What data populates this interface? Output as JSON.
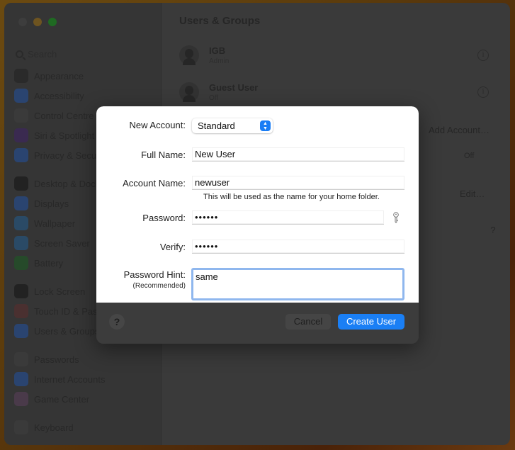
{
  "window": {
    "title": "Users & Groups"
  },
  "sidebar": {
    "search_placeholder": "Search",
    "groups": [
      [
        {
          "label": "Appearance",
          "icon": "appearance-icon",
          "color": "#2a2a2a"
        },
        {
          "label": "Accessibility",
          "icon": "accessibility-icon",
          "color": "#2a4470"
        },
        {
          "label": "Control Centre",
          "icon": "control-centre-icon",
          "color": "#3a3a3a"
        },
        {
          "label": "Siri & Spotlight",
          "icon": "siri-icon",
          "color": "#3a2a50"
        },
        {
          "label": "Privacy & Security",
          "icon": "privacy-hand-icon",
          "color": "#2a4470"
        }
      ],
      [
        {
          "label": "Desktop & Dock",
          "icon": "desktop-dock-icon",
          "color": "#222222"
        },
        {
          "label": "Displays",
          "icon": "displays-icon",
          "color": "#2a4470"
        },
        {
          "label": "Wallpaper",
          "icon": "wallpaper-icon",
          "color": "#2a4a66"
        },
        {
          "label": "Screen Saver",
          "icon": "screen-saver-icon",
          "color": "#2a4a66"
        },
        {
          "label": "Battery",
          "icon": "battery-icon",
          "color": "#264a2a"
        }
      ],
      [
        {
          "label": "Lock Screen",
          "icon": "lock-screen-icon",
          "color": "#222222"
        },
        {
          "label": "Touch ID & Password",
          "icon": "fingerprint-icon",
          "color": "#4a3030"
        },
        {
          "label": "Users & Groups",
          "icon": "users-groups-icon",
          "color": "#2a4470"
        }
      ],
      [
        {
          "label": "Passwords",
          "icon": "passwords-key-icon",
          "color": "#3a3a3a"
        },
        {
          "label": "Internet Accounts",
          "icon": "internet-accounts-icon",
          "color": "#2a4470"
        },
        {
          "label": "Game Center",
          "icon": "game-center-icon",
          "color": "#4a3a4a"
        }
      ],
      [
        {
          "label": "Keyboard",
          "icon": "keyboard-icon",
          "color": "#3a3a3a"
        }
      ]
    ]
  },
  "main": {
    "users": [
      {
        "name": "IGB",
        "role": "Admin"
      },
      {
        "name": "Guest User",
        "role": "Off"
      }
    ],
    "add_account_label": "Add Account…",
    "off_label": "Off",
    "edit_label": "Edit…",
    "help_label": "?"
  },
  "dialog": {
    "new_account_label": "New Account:",
    "new_account_value": "Standard",
    "full_name_label": "Full Name:",
    "full_name_value": "New User",
    "account_name_label": "Account Name:",
    "account_name_value": "newuser",
    "account_name_note": "This will be used as the name for your home folder.",
    "password_label": "Password:",
    "password_value": "••••••",
    "verify_label": "Verify:",
    "verify_value": "••••••",
    "hint_label": "Password Hint:",
    "hint_sublabel": "(Recommended)",
    "hint_value": "same",
    "help_label": "?",
    "cancel_label": "Cancel",
    "create_label": "Create User",
    "accent_color": "#1a7ff5"
  }
}
